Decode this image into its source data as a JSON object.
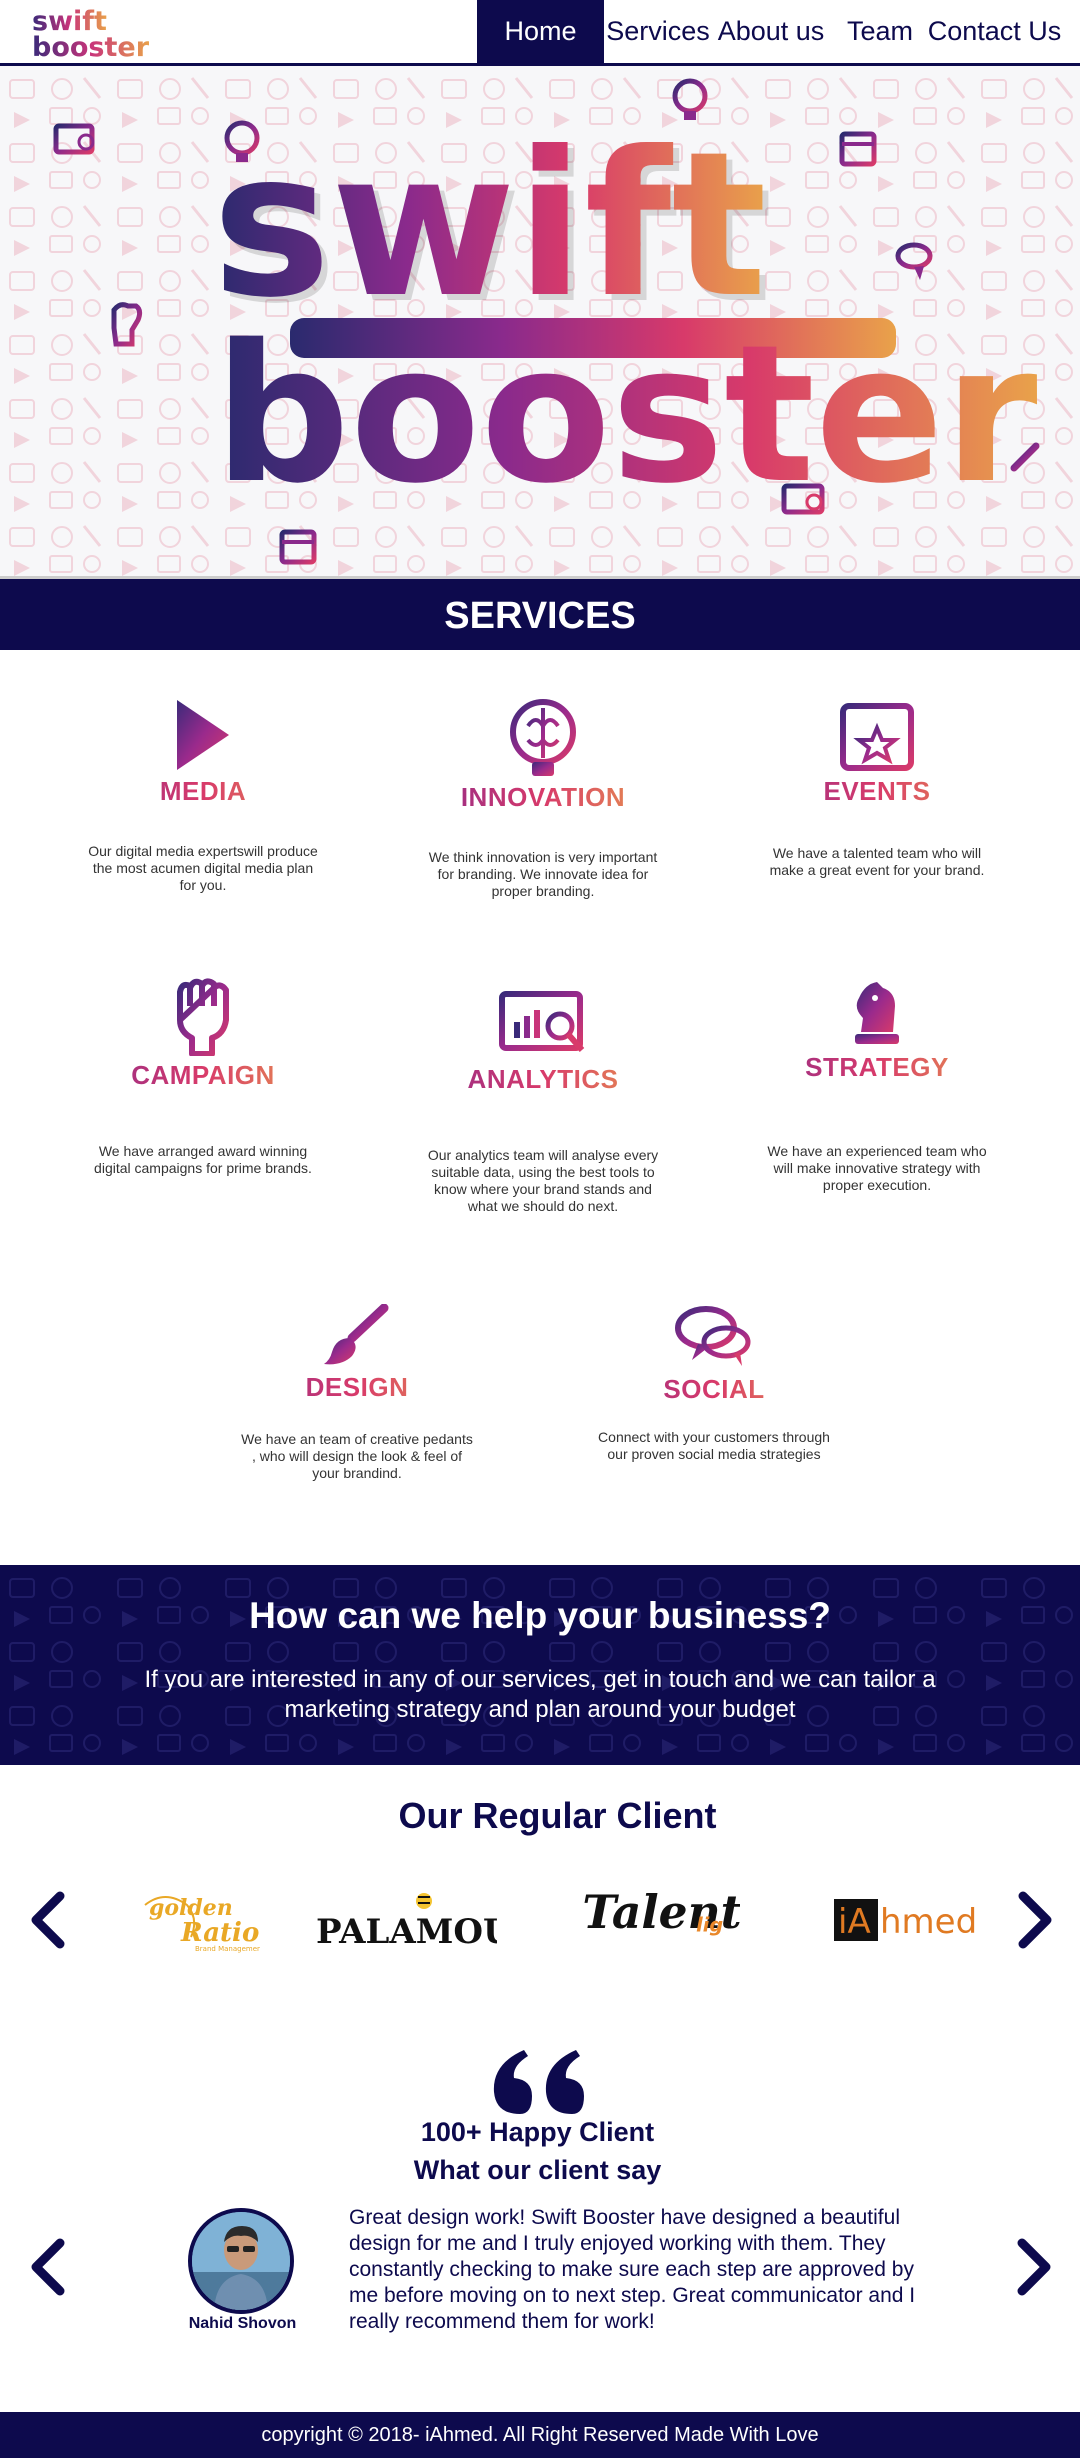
{
  "brand": {
    "logo_line1": "swift",
    "logo_line2": "booster",
    "hero_line1": "swift",
    "hero_line2": "booster",
    "gradient": [
      "#2a2a6e",
      "#8a2a8c",
      "#d83a6a",
      "#e9a24a"
    ]
  },
  "nav": {
    "items": [
      {
        "label": "Home",
        "active": true
      },
      {
        "label": "Services",
        "active": false
      },
      {
        "label": "About us",
        "active": false
      },
      {
        "label": "Team",
        "active": false
      },
      {
        "label": "Contact Us",
        "active": false
      }
    ]
  },
  "services": {
    "title": "SERVICES",
    "items": [
      {
        "name": "MEDIA",
        "icon": "play-icon",
        "desc": "Our digital media expertswill produce the most acumen digital media plan for you."
      },
      {
        "name": "INNOVATION",
        "icon": "brain-icon",
        "desc": "We think innovation is very important for branding. We innovate idea for proper branding."
      },
      {
        "name": "EVENTS",
        "icon": "calendar-star-icon",
        "desc": "We have a talented team who will make a great event for your brand."
      },
      {
        "name": "CAMPAIGN",
        "icon": "raised-fist-icon",
        "desc": "We have arranged  award winning digital campaigns for prime brands."
      },
      {
        "name": "ANALYTICS",
        "icon": "analytics-screen-icon",
        "desc": "Our analytics team will analyse every suitable  data, using the best  tools to know where your brand stands and what we should do next."
      },
      {
        "name": "STRATEGY",
        "icon": "chess-knight-icon",
        "desc": "We have an experienced team who will make innovative strategy with proper execution."
      },
      {
        "name": "DESIGN",
        "icon": "paintbrush-icon",
        "desc": "We have an  team of creative pedants , who will design the look & feel of your brandind."
      },
      {
        "name": "SOCIAL",
        "icon": "chat-bubbles-icon",
        "desc": "Connect with your customers through our proven social media strategies"
      }
    ]
  },
  "help": {
    "title": "How can we help your business?",
    "text": "If you are interested in any of our services, get in touch and we can tailor a marketing strategy and plan around your budget"
  },
  "clients": {
    "title": "Our Regular Client",
    "logos": [
      {
        "name": "golden Ratio",
        "line1": "golden",
        "line2": "Ratio",
        "tagline": "Brand Management",
        "color": "#e9a826"
      },
      {
        "name": "PALAMOU",
        "text": "PALAMOU",
        "color": "#111111"
      },
      {
        "name": "Talent lig",
        "main": "Talent",
        "suffix": "lig",
        "color": "#111111",
        "accent": "#e9882a"
      },
      {
        "name": "iAhmed",
        "boxed": "iA",
        "rest": "hmed",
        "color": "#e07a22"
      }
    ]
  },
  "testimonial": {
    "count_line": "100+ Happy Client",
    "subtitle": "What our client say",
    "text": "Great design work! Swift Booster have designed a beautiful design for me and I truly enjoyed working with them. They constantly checking to make sure each step are approved by me before moving on to next step. Great communicator and I really recommend them for work!",
    "client_name": "Nahid Shovon"
  },
  "footer": {
    "text": "copyright © 2018- iAhmed. All Right Reserved Made With Love"
  },
  "colors": {
    "navy": "#0d0a4d",
    "purple": "#8a2a8c",
    "pink": "#d83a6a",
    "orange": "#e9a24a"
  }
}
